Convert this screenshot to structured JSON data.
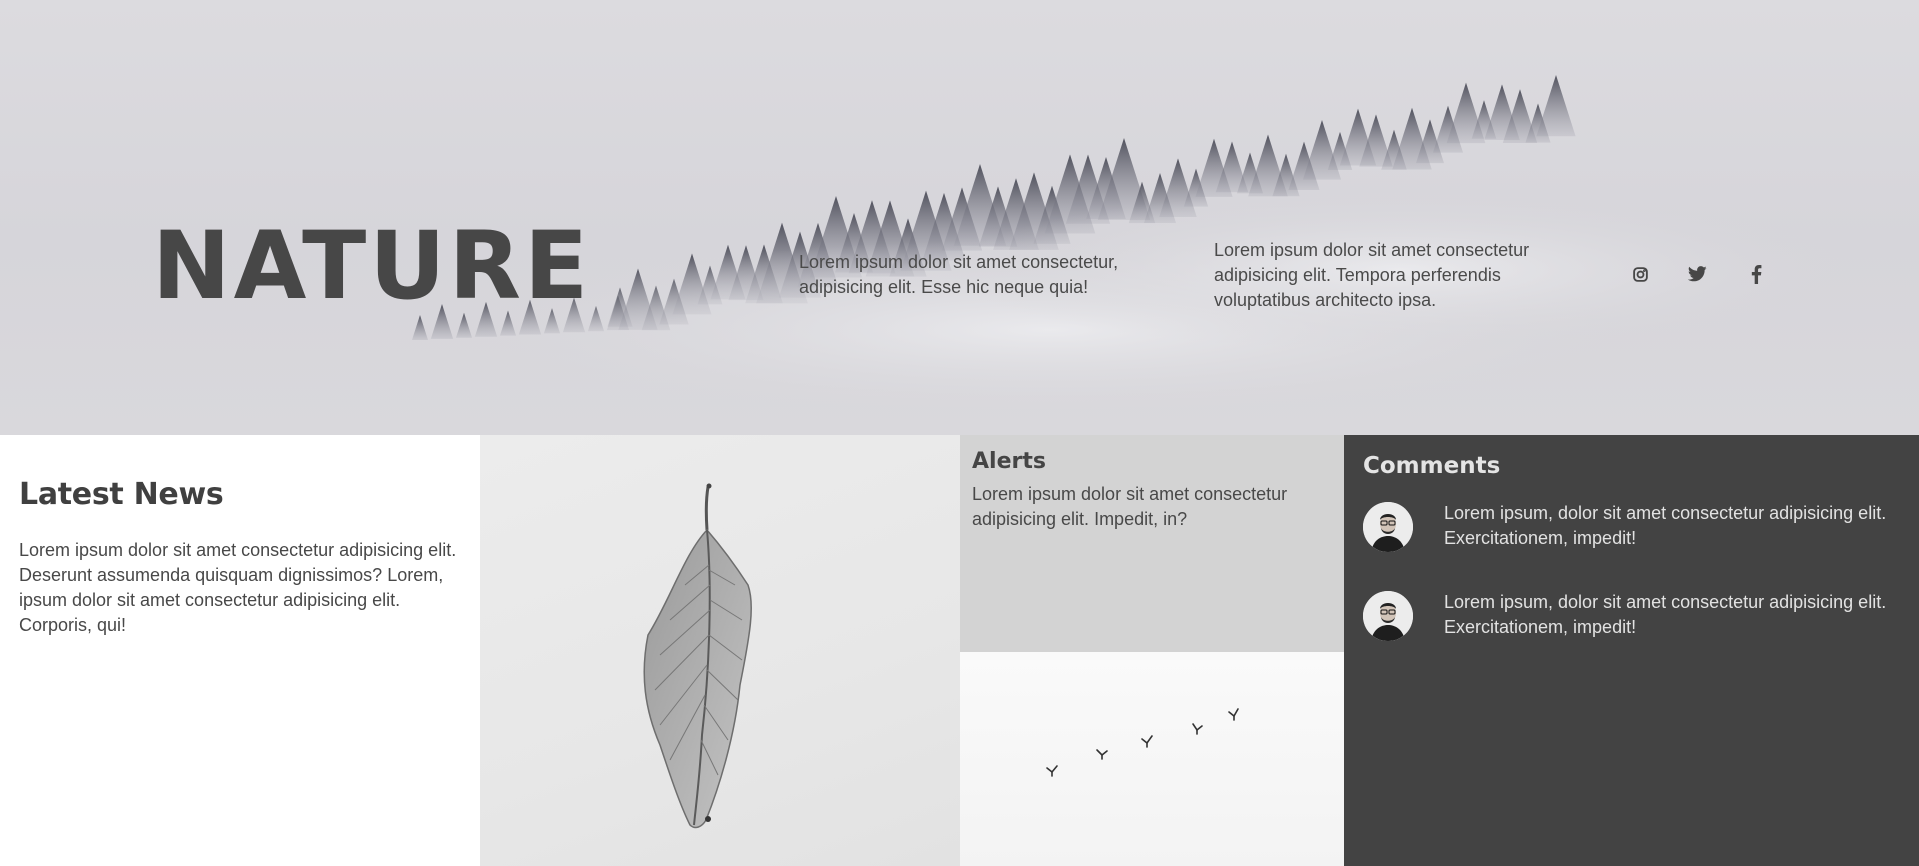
{
  "hero": {
    "title": "NATURE",
    "text_one": "Lorem ipsum dolor sit amet consectetur, adipisicing elit. Esse hic neque quia!",
    "text_two": "Lorem ipsum dolor sit amet consectetur adipisicing elit. Tempora perferendis voluptatibus architecto ipsa.",
    "social": [
      "instagram-icon",
      "twitter-icon",
      "facebook-icon"
    ]
  },
  "news": {
    "title": "Latest News",
    "body": "Lorem ipsum dolor sit amet consectetur adipisicing elit. Deserunt assumenda quisquam dignissimos? Lorem, ipsum dolor sit amet consectetur adipisicing elit. Corporis, qui!"
  },
  "alerts": {
    "title": "Alerts",
    "body": "Lorem ipsum dolor sit amet consectetur adipisicing elit. Impedit, in?"
  },
  "comments": {
    "title": "Comments",
    "items": [
      {
        "text": "Lorem ipsum, dolor sit amet consectetur adipisicing elit. Exercitationem, impedit!"
      },
      {
        "text": "Lorem ipsum, dolor sit amet consectetur adipisicing elit. Exercitationem, impedit!"
      }
    ]
  },
  "colors": {
    "hero_bg": "#d8d7db",
    "title": "#474747",
    "alerts_bg": "#d3d3d3",
    "comments_bg": "#434343"
  }
}
